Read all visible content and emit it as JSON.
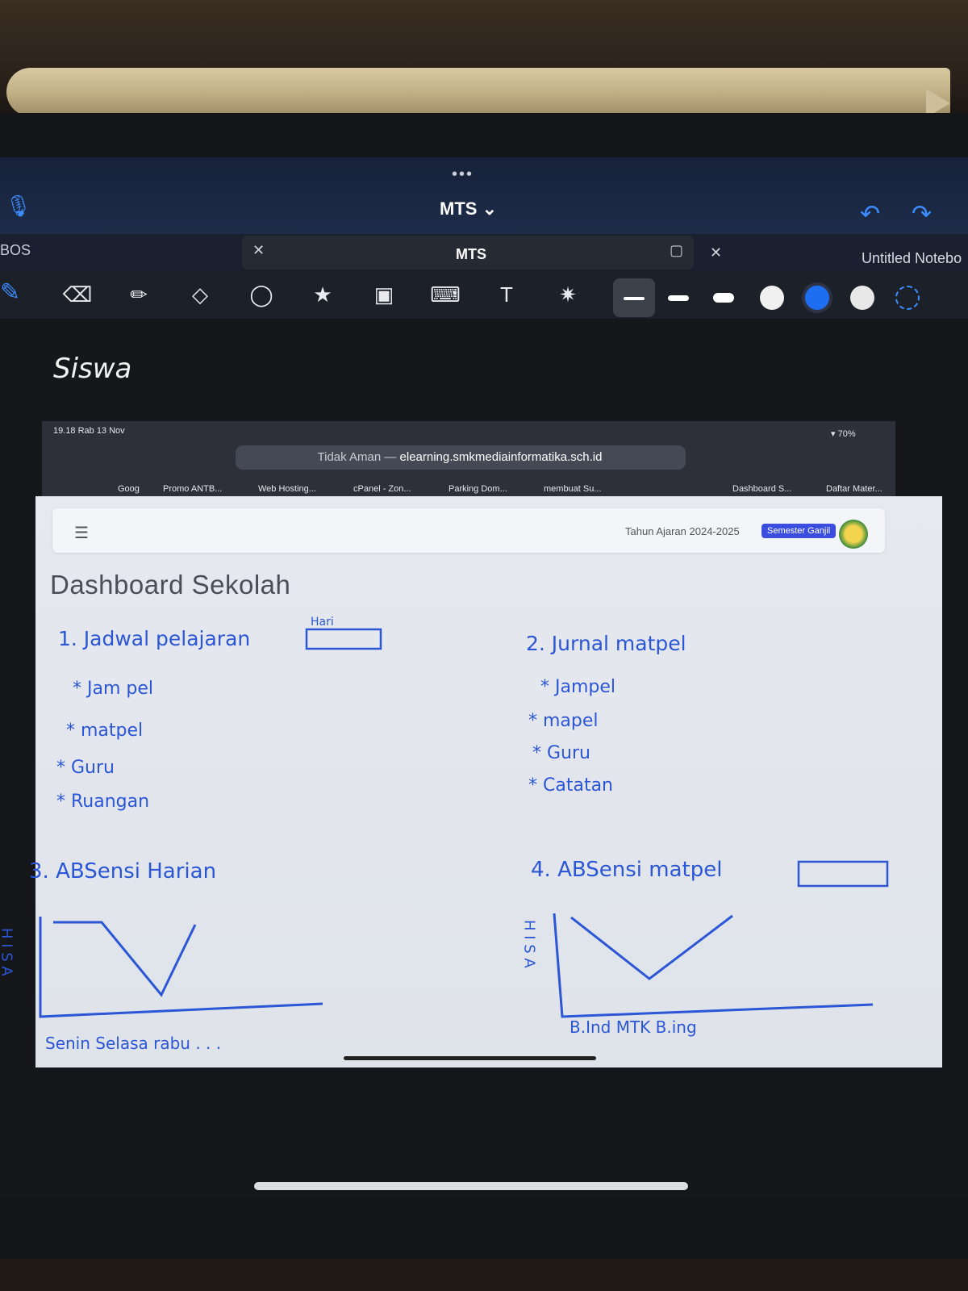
{
  "notes_app": {
    "title": "MTS",
    "tab_left": "BOS",
    "tab_center": "MTS",
    "tab_right": "Untitled Notebo",
    "handwritten_heading": "Siswa",
    "icons": [
      "mic-icon",
      "undo-icon",
      "redo-icon",
      "pen-icon",
      "eraser-icon",
      "highlighter-icon",
      "shapes-icon",
      "lasso-icon",
      "sticker-icon",
      "image-icon",
      "keyboard-icon",
      "text-icon",
      "laser-icon"
    ],
    "colors": {
      "accent": "#3b8cff",
      "ink": "#2b56d6",
      "swatch_selected": "#1e6ef2"
    }
  },
  "browser": {
    "status_time": "19.18  Rab 13 Nov",
    "battery": "70%",
    "url_prefix": "Tidak Aman —",
    "url_domain": "elearning.smkmediainformatika.sch.id",
    "bookmarks": [
      {
        "label": "Goog"
      },
      {
        "label": "Promo ANTB..."
      },
      {
        "label": "Web Hosting..."
      },
      {
        "label": "cPanel - Zon..."
      },
      {
        "label": "Parking Dom..."
      },
      {
        "label": "membuat Su..."
      },
      {
        "label": "Dashboard S..."
      },
      {
        "label": "Daftar Mater..."
      }
    ]
  },
  "webpage": {
    "academic_year": "Tahun Ajaran 2024-2025",
    "semester_badge": "Semester Ganjil",
    "page_title": "Dashboard Sekolah"
  },
  "handwriting": {
    "section1": {
      "title": "1. Jadwal pelajaran",
      "tag": "Hari",
      "items": [
        "* Jam pel",
        "* matpel",
        "* Guru",
        "* Ruangan"
      ]
    },
    "section2": {
      "title": "2. Jurnal matpel",
      "items": [
        "* Jampel",
        "* mapel",
        "* Guru",
        "* Catatan"
      ]
    },
    "section3": {
      "title": "3. ABSensi Harian",
      "yaxis": "H I S A",
      "xaxis": "Senin  Selasa  rabu . . ."
    },
    "section4": {
      "title": "4. ABSensi matpel",
      "yaxis": "H I S A",
      "xaxis": "B.Ind  MTK  B.ing"
    }
  }
}
